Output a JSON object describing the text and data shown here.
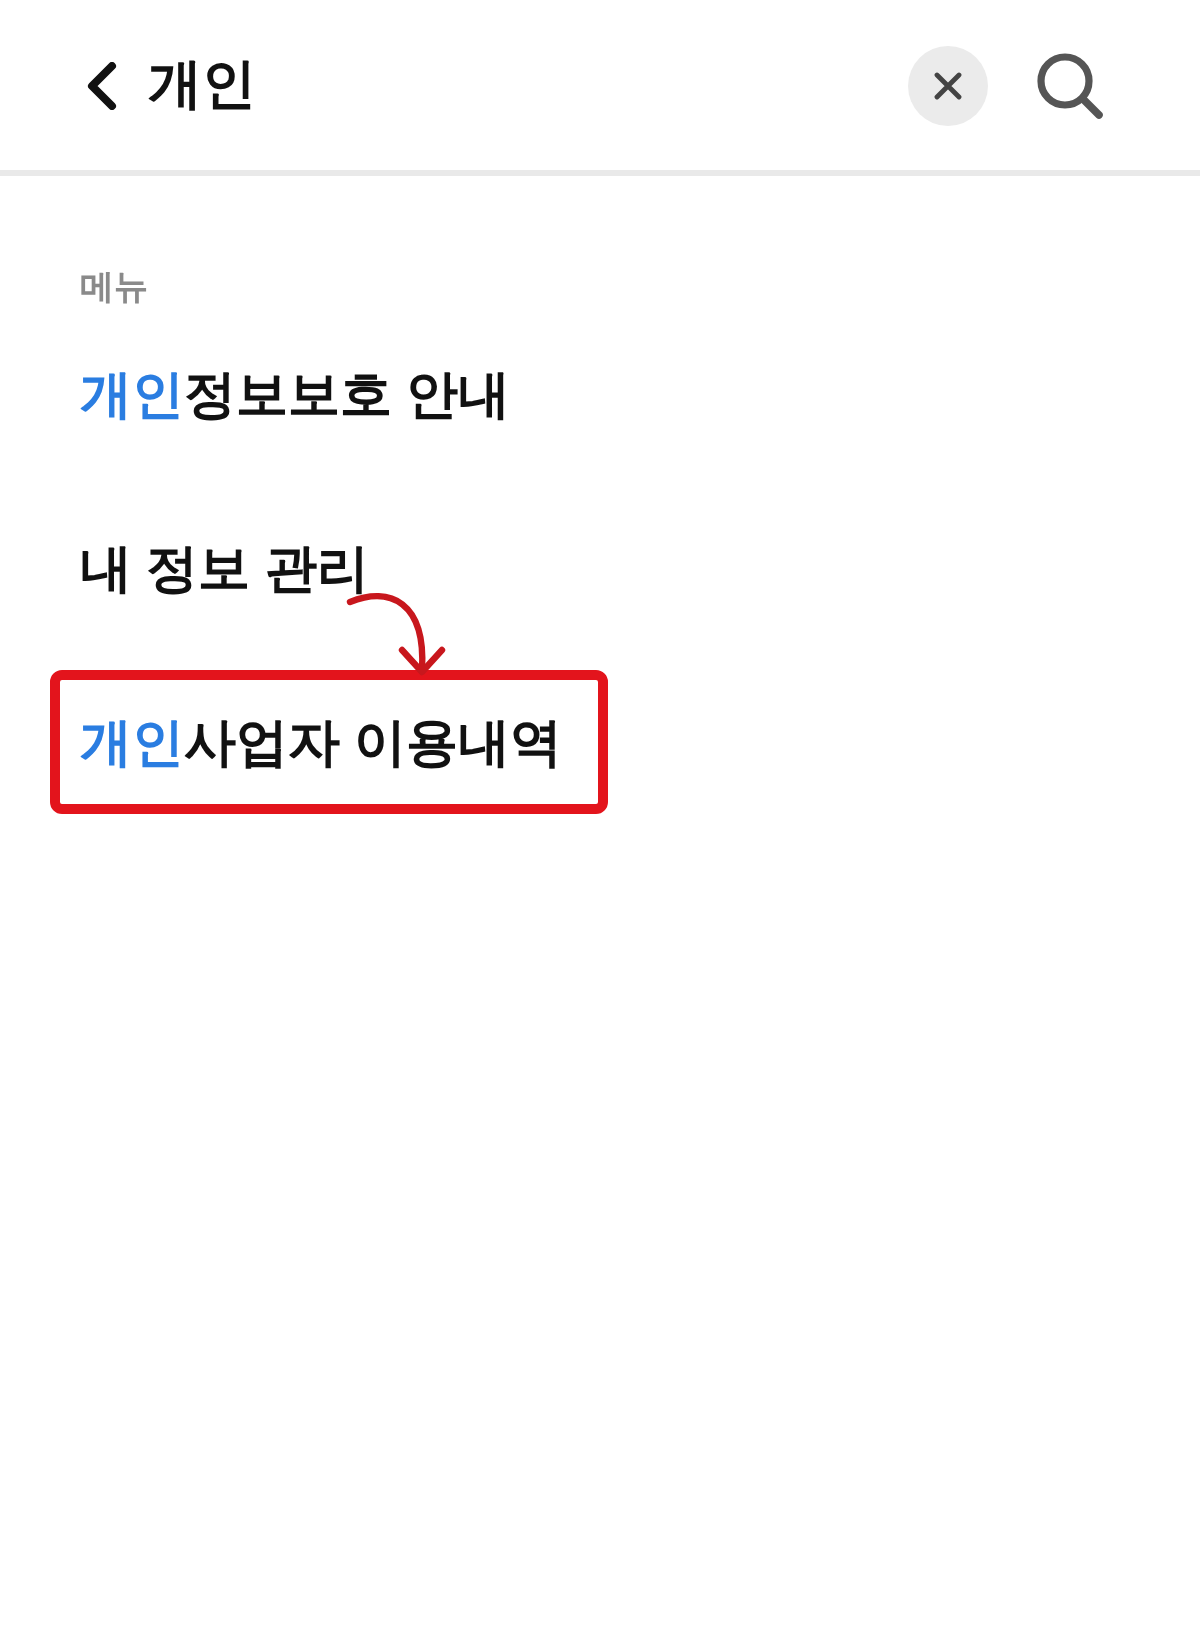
{
  "search": {
    "value": "개인"
  },
  "section": {
    "title": "메뉴"
  },
  "items": [
    {
      "matched_part": "개인",
      "rest": "정보보호 안내",
      "outlined": false,
      "pointed_at": false
    },
    {
      "rest": "내 정보 관리",
      "outlined": false,
      "pointed_at": false
    },
    {
      "matched_part": "개인",
      "rest": "사업자 이용내역",
      "outlined": true,
      "pointed_at": true
    }
  ]
}
